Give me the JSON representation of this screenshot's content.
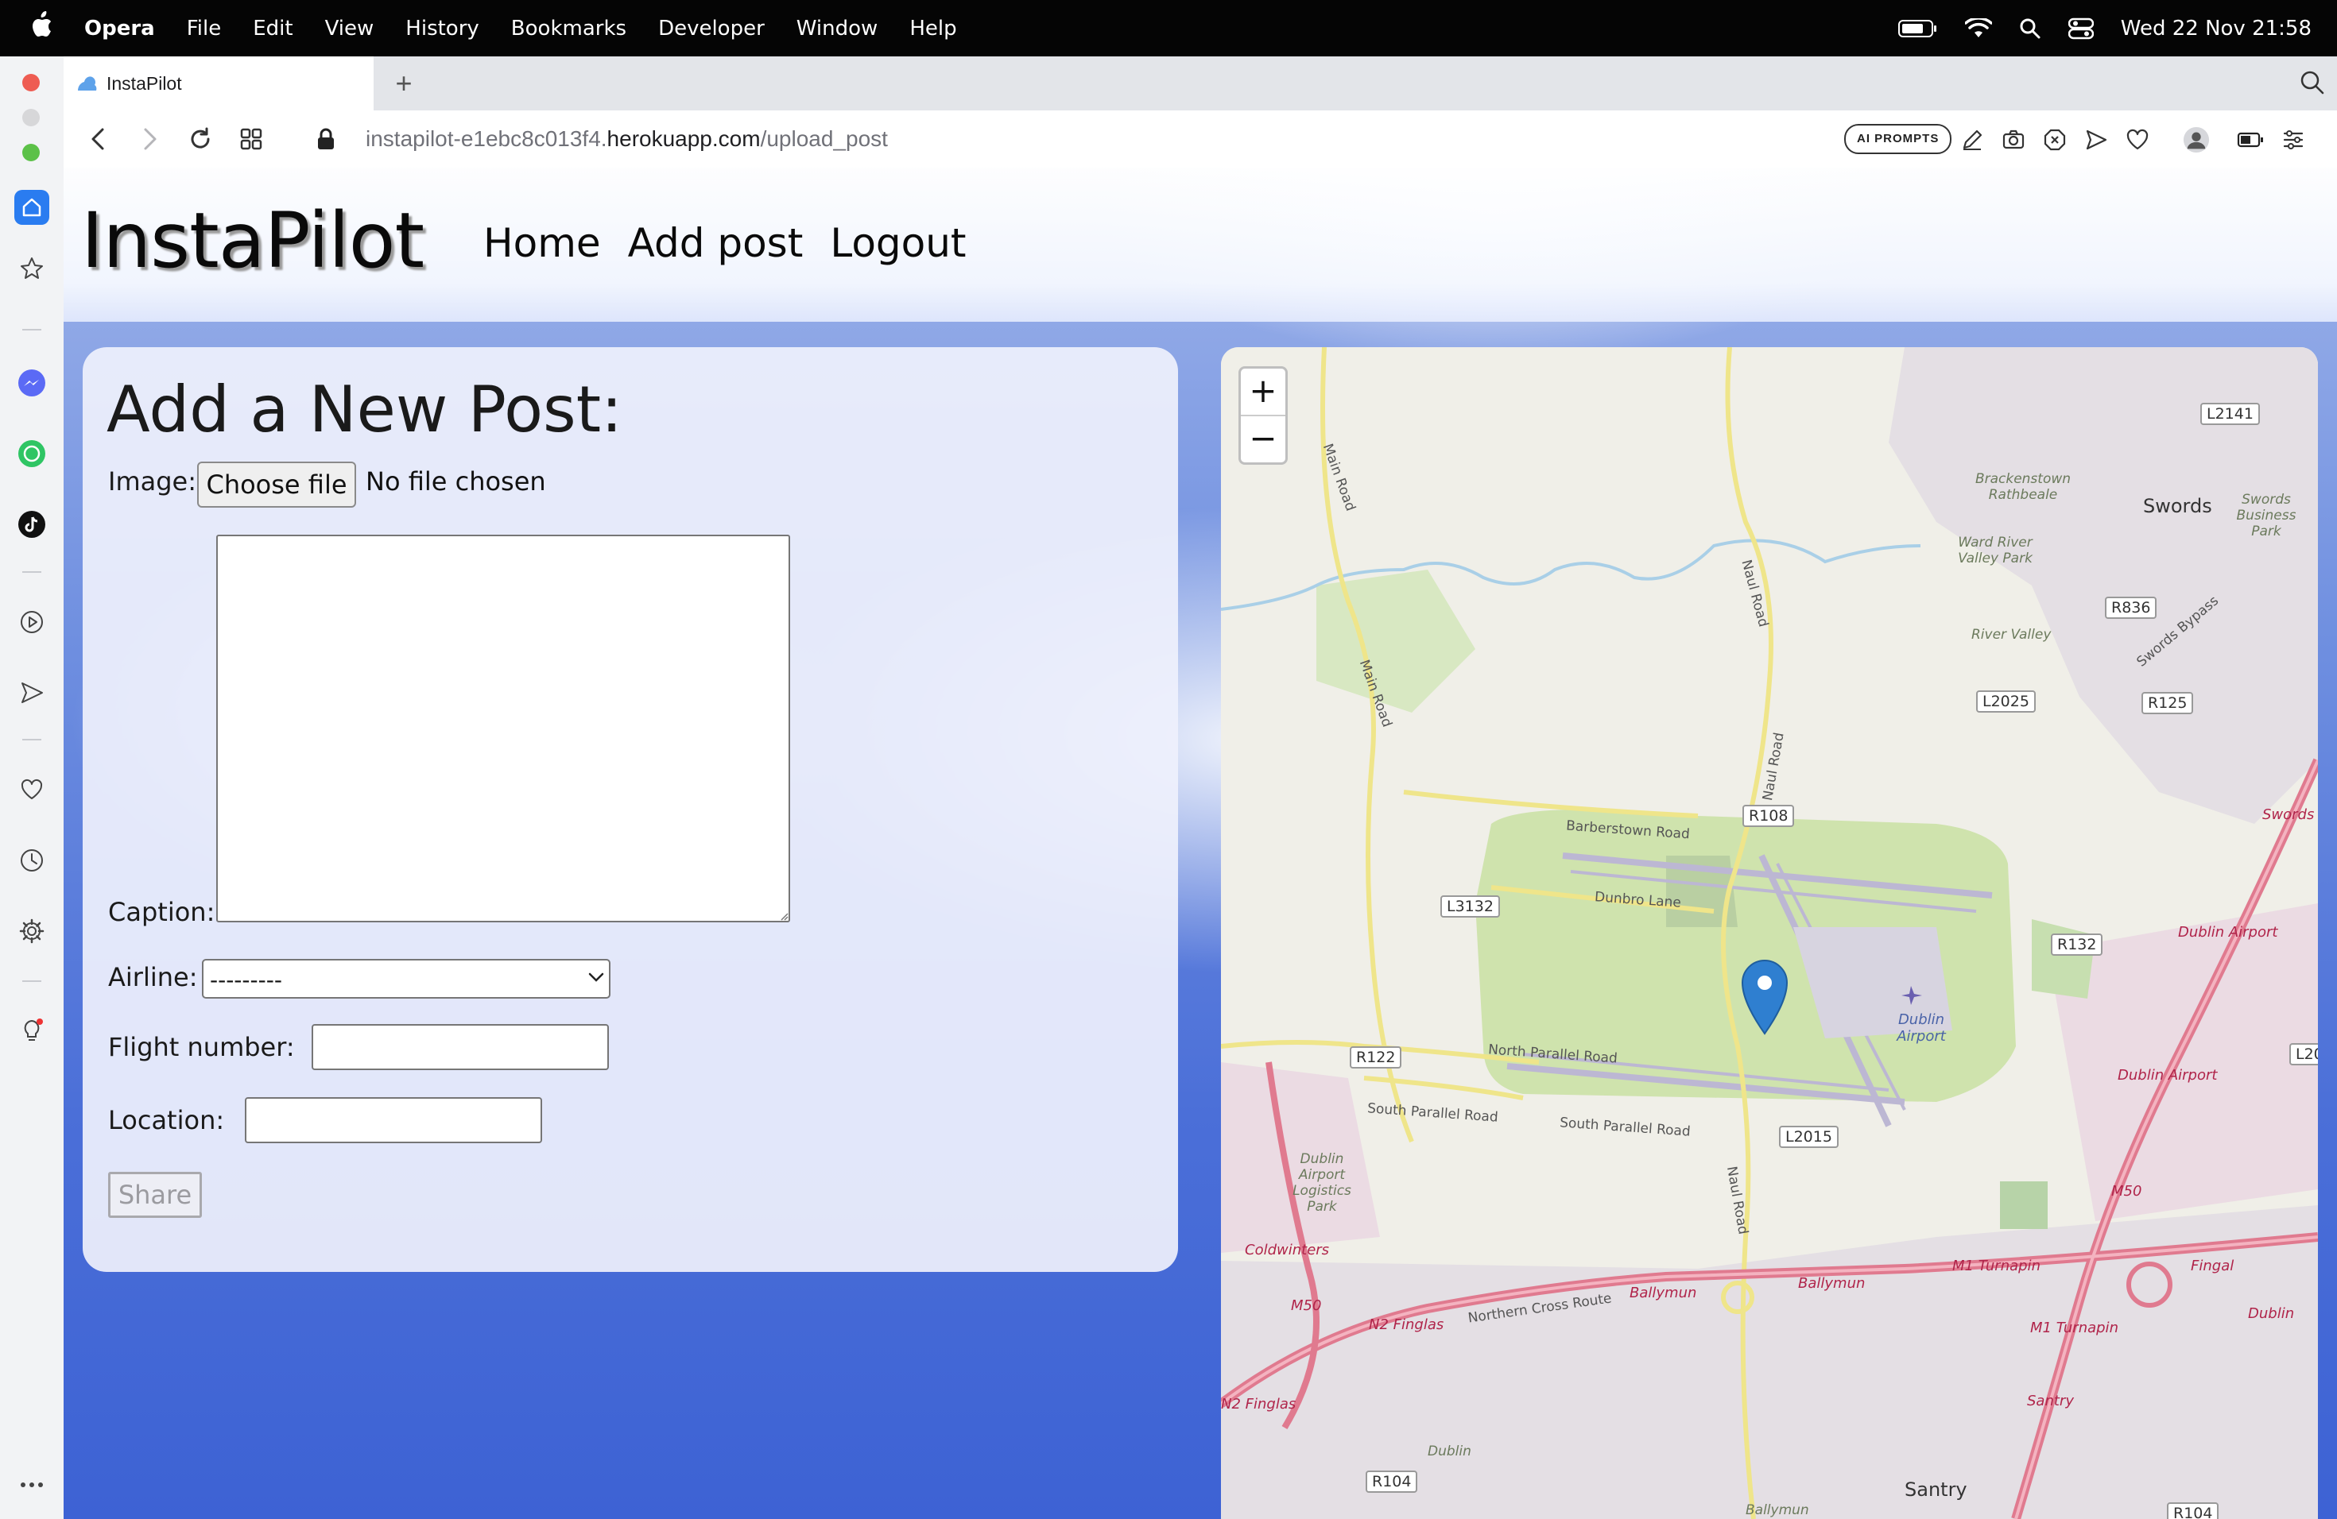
{
  "menubar": {
    "app": "Opera",
    "menus": [
      "File",
      "Edit",
      "View",
      "History",
      "Bookmarks",
      "Developer",
      "Window",
      "Help"
    ],
    "clock": "Wed 22 Nov  21:58"
  },
  "browser": {
    "tab_title": "InstaPilot",
    "url_prefix": "instapilot-e1ebc8c013f4.",
    "url_host": "herokuapp.com",
    "url_path": "/upload_post",
    "ai_prompts_label": "AI PROMPTS"
  },
  "site": {
    "brand": "InstaPilot",
    "nav": [
      "Home",
      "Add post",
      "Logout"
    ]
  },
  "form": {
    "title": "Add a New Post:",
    "image_label": "Image:",
    "choose_file_label": "Choose file",
    "no_file_text": "No file chosen",
    "caption_label": "Caption:",
    "caption_value": "",
    "airline_label": "Airline:",
    "airline_selected": "---------",
    "flight_number_label": "Flight number:",
    "flight_number_value": "",
    "location_label": "Location:",
    "location_value": "",
    "share_label": "Share"
  },
  "map": {
    "zoom_in": "+",
    "zoom_out": "−",
    "towns": [
      "Swords",
      "Santry",
      "Dublin Airport"
    ],
    "roads": [
      "L2141",
      "R836",
      "R125",
      "L2025",
      "R108",
      "L3132",
      "R132",
      "R122",
      "L2015",
      "R104",
      "R104",
      "L20"
    ],
    "street_names": [
      "Main Road",
      "Main Road",
      "Naul Road",
      "Naul Road",
      "Naul Road",
      "Barberstown Road",
      "Dunbro Lane",
      "North Parallel Road",
      "South Parallel Road",
      "South Parallel Road",
      "Northern Cross Route",
      "Swords Bypass"
    ],
    "pink_labels": [
      "Swords",
      "Dublin Airport",
      "Dublin Airport",
      "M50",
      "M50",
      "M1 Turnapin",
      "M1 Turnapin",
      "Ballymun",
      "Ballymun",
      "N2 Finglas",
      "N2 Finglas",
      "Coldwinters",
      "Santry",
      "Fingal",
      "Dublin"
    ],
    "area_labels": [
      "Brackenstown Rathbeale",
      "Ward River Valley Park",
      "River Valley",
      "Swords Business Park",
      "Dublin Airport Logistics Park",
      "Dublin",
      "Ballymun"
    ]
  }
}
